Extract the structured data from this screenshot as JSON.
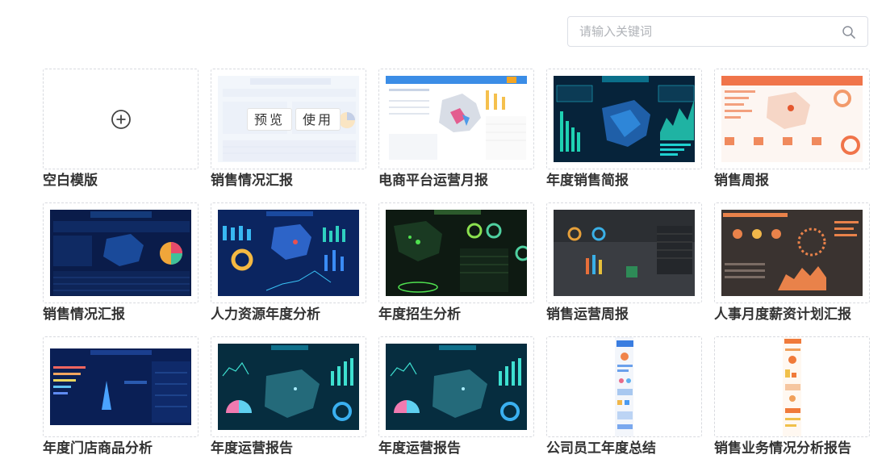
{
  "search": {
    "placeholder": "请输入关键词",
    "icon": "search-icon"
  },
  "hover_actions": {
    "preview": "预览",
    "use": "使用"
  },
  "templates": [
    {
      "label": "空白模版",
      "theme": "blank"
    },
    {
      "label": "销售情况汇报",
      "theme": "light-blue"
    },
    {
      "label": "电商平台运营月报",
      "theme": "light-map"
    },
    {
      "label": "年度销售简报",
      "theme": "dark-teal"
    },
    {
      "label": "销售周报",
      "theme": "light-orange"
    },
    {
      "label": "销售情况汇报",
      "theme": "navy"
    },
    {
      "label": "人力资源年度分析",
      "theme": "navy-map"
    },
    {
      "label": "年度招生分析",
      "theme": "dark-green"
    },
    {
      "label": "销售运营周报",
      "theme": "photo-dark"
    },
    {
      "label": "人事月度薪资计划汇报",
      "theme": "photo-brown"
    },
    {
      "label": "年度门店商品分析",
      "theme": "navy-bars"
    },
    {
      "label": "年度运营报告",
      "theme": "teal-map"
    },
    {
      "label": "年度运营报告",
      "theme": "teal-map"
    },
    {
      "label": "公司员工年度总结",
      "theme": "mobile-blue"
    },
    {
      "label": "销售业务情况分析报告",
      "theme": "mobile-orange"
    }
  ],
  "colors": {
    "accent": "#1890ff",
    "border": "#d8dadf",
    "text": "#333333"
  }
}
